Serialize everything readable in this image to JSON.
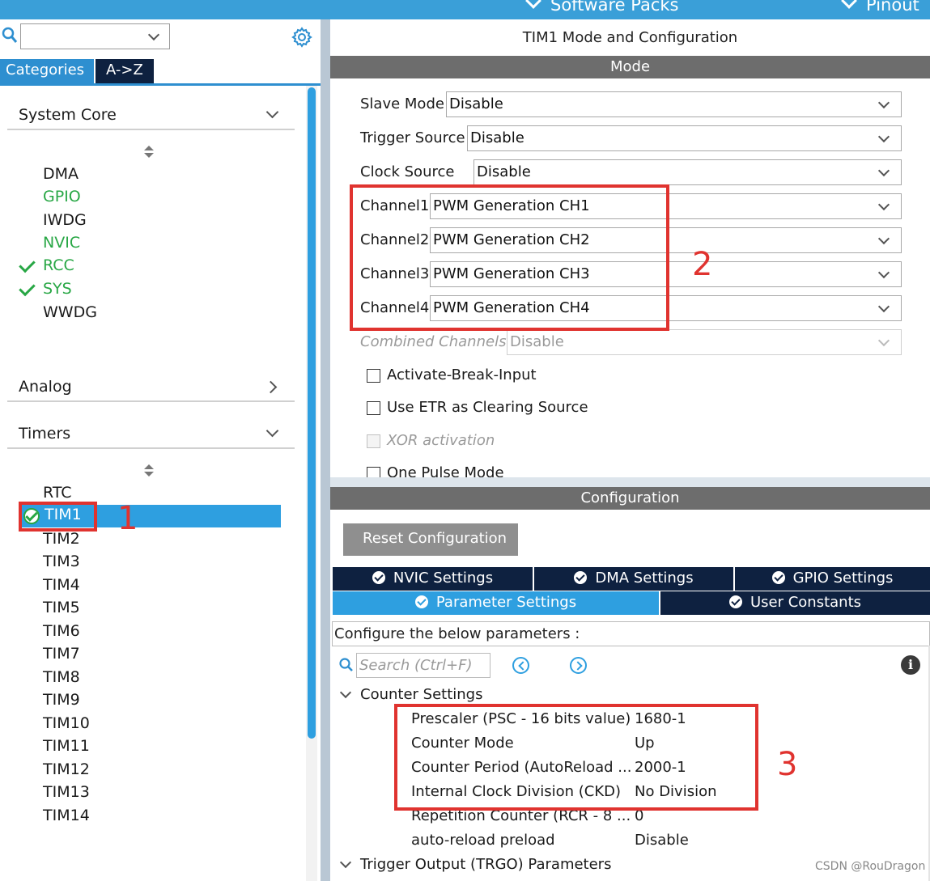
{
  "topbar": {
    "software_packs": "Software Packs",
    "pinout": "Pinout"
  },
  "left": {
    "search": {
      "value": "",
      "placeholder": ""
    },
    "tabs": {
      "categories": "Categories",
      "az": "A->Z"
    },
    "system_core": {
      "title": "System Core",
      "items": [
        "DMA",
        "GPIO",
        "IWDG",
        "NVIC",
        "RCC",
        "SYS",
        "WWDG"
      ]
    },
    "analog": {
      "title": "Analog"
    },
    "timers": {
      "title": "Timers",
      "items": [
        "RTC",
        "TIM1",
        "TIM2",
        "TIM3",
        "TIM4",
        "TIM5",
        "TIM6",
        "TIM7",
        "TIM8",
        "TIM9",
        "TIM10",
        "TIM11",
        "TIM12",
        "TIM13",
        "TIM14"
      ],
      "selected": "TIM1"
    }
  },
  "mode": {
    "title": "TIM1 Mode and Configuration",
    "section": "Mode",
    "fields": [
      {
        "label": "Slave Mode",
        "value": "Disable"
      },
      {
        "label": "Trigger Source",
        "value": "Disable"
      },
      {
        "label": "Clock Source",
        "value": "Disable"
      },
      {
        "label": "Channel1",
        "value": "PWM Generation CH1"
      },
      {
        "label": "Channel2",
        "value": "PWM Generation CH2"
      },
      {
        "label": "Channel3",
        "value": "PWM Generation CH3"
      },
      {
        "label": "Channel4",
        "value": "PWM Generation CH4"
      },
      {
        "label": "Combined Channels",
        "value": "Disable"
      }
    ],
    "checkboxes": [
      {
        "label": "Activate-Break-Input",
        "checked": false
      },
      {
        "label": "Use ETR as Clearing Source",
        "checked": false
      },
      {
        "label": "XOR activation",
        "checked": false
      },
      {
        "label": "One Pulse Mode",
        "checked": false
      }
    ]
  },
  "configuration": {
    "section": "Configuration",
    "reset_label": "Reset Configuration",
    "tabs": [
      "NVIC Settings",
      "DMA Settings",
      "GPIO Settings",
      "Parameter Settings",
      "User Constants"
    ],
    "active_tab": "Parameter Settings",
    "hint": "Configure the below parameters :",
    "search_placeholder": "Search (Ctrl+F)",
    "groups": [
      {
        "title": "Counter Settings",
        "params": [
          {
            "name": "Prescaler (PSC - 16 bits value)",
            "value": "1680-1"
          },
          {
            "name": "Counter Mode",
            "value": "Up"
          },
          {
            "name": "Counter Period (AutoReload ...",
            "value": "2000-1"
          },
          {
            "name": "Internal Clock Division (CKD)",
            "value": "No Division"
          },
          {
            "name": "Repetition Counter (RCR - 8 ...",
            "value": "0"
          },
          {
            "name": "auto-reload preload",
            "value": "Disable"
          }
        ]
      },
      {
        "title": "Trigger Output (TRGO) Parameters"
      }
    ]
  },
  "annotations": [
    "1",
    "2",
    "3"
  ],
  "watermark": "CSDN @RouDragon",
  "colors": {
    "accent": "#2e9fe0",
    "dark_tab": "#0e2140",
    "band": "#6d6d6d",
    "ok_green": "#28a745",
    "annotation_red": "#e0332f"
  }
}
